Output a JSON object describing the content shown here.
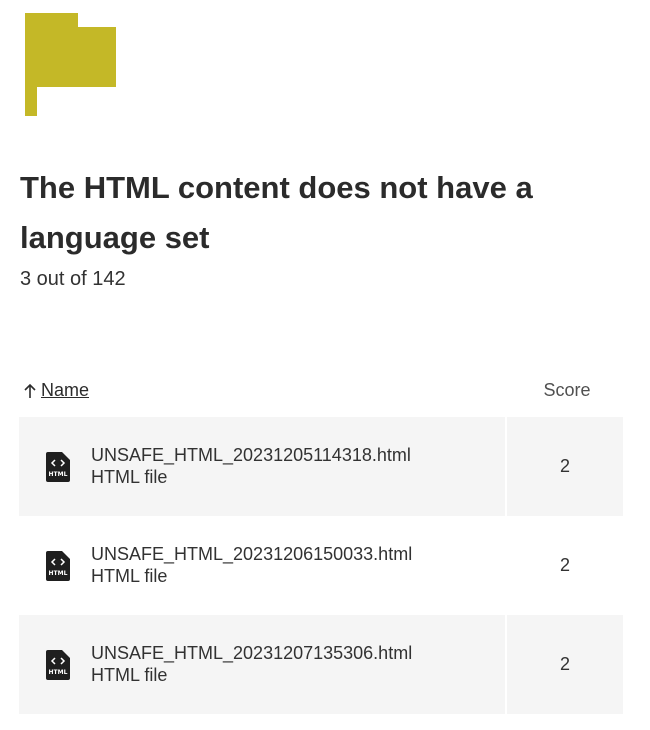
{
  "heading": {
    "title": "The HTML content does not have a language set",
    "count": "3 out of 142"
  },
  "table": {
    "columns": {
      "name": "Name",
      "score": "Score"
    },
    "sort_icon": "arrow-up-icon",
    "rows": [
      {
        "filename": "UNSAFE_HTML_20231205114318.html",
        "type": "HTML file",
        "score": "2"
      },
      {
        "filename": "UNSAFE_HTML_20231206150033.html",
        "type": "HTML file",
        "score": "2"
      },
      {
        "filename": "UNSAFE_HTML_20231207135306.html",
        "type": "HTML file",
        "score": "2"
      }
    ]
  },
  "icons": {
    "flag": "flag-icon",
    "file": "html-file-icon"
  },
  "colors": {
    "flag": "#c4b827",
    "row_shade": "#f5f5f5",
    "text": "#323232"
  }
}
